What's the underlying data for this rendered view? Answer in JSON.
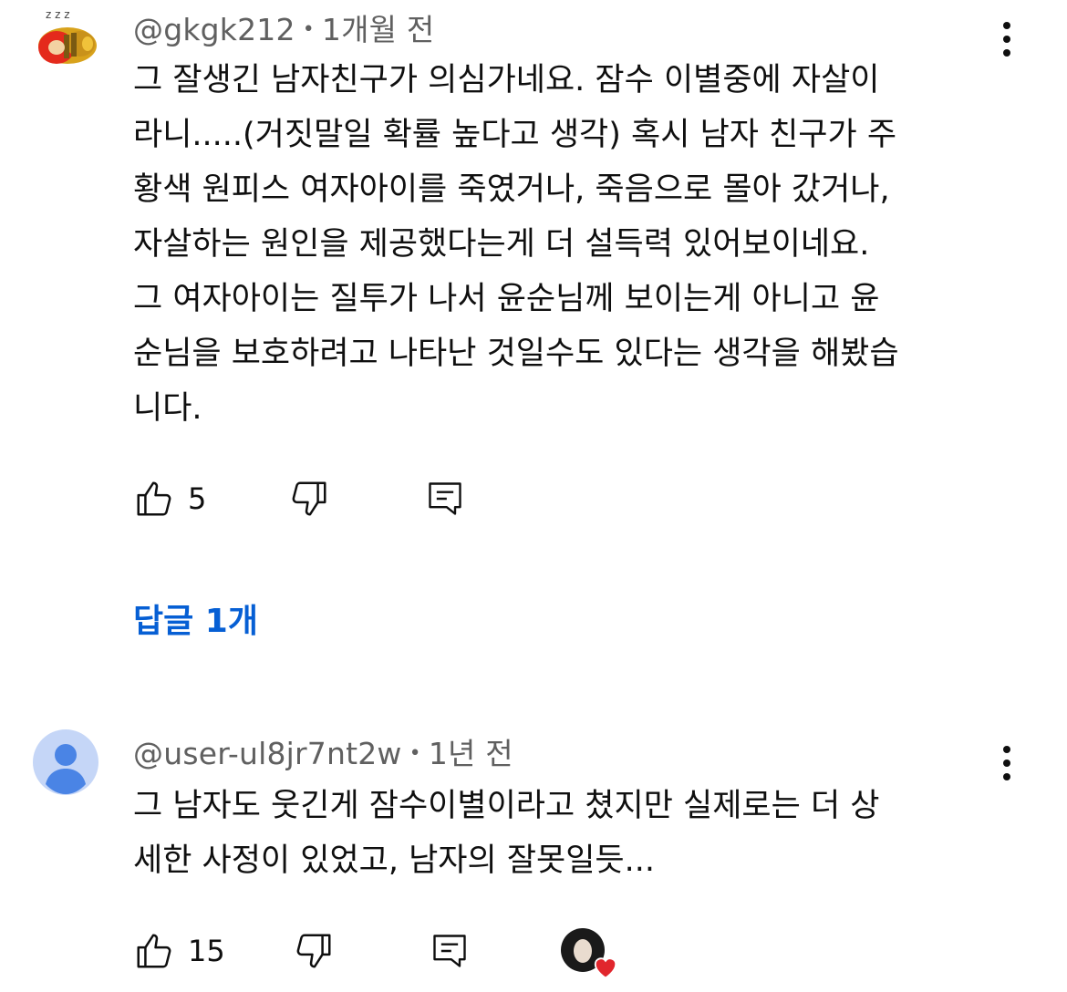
{
  "comments": [
    {
      "author": "@gkgk212",
      "time": "1개월 전",
      "text": "그 잘생긴 남자친구가 의심가네요. 잠수 이별중에 자살이\n라니.....(거짓말일 확률 높다고 생각) 혹시 남자 친구가 주\n황색 원피스 여자아이를 죽였거나,  죽음으로 몰아 갔거나,\n자살하는 원인을 제공했다는게 더 설득력 있어보이네요.\n그 여자아이는 질투가 나서 윤순님께 보이는게 아니고 윤\n순님을 보호하려고 나타난 것일수도 있다는 생각을 해봤습\n니다.",
      "likes": "5",
      "replies_label": "답글 1개",
      "avatar_sleep": "z z z"
    },
    {
      "author": "@user-ul8jr7nt2w",
      "time": "1년 전",
      "text": "그 남자도 웃긴게 잠수이별이라고 쳤지만 실제로는 더 상\n세한 사정이 있었고, 남자의 잘못일듯...",
      "likes": "15"
    }
  ],
  "separator": "•",
  "colors": {
    "link_blue": "#065fd4",
    "meta_gray": "#606060",
    "default_avatar_bg": "#c5d6f7",
    "default_avatar_fg": "#4a84e5",
    "heart_red": "#e1262d"
  },
  "icons": [
    "like-icon",
    "dislike-icon",
    "reply-icon",
    "more-vert-icon",
    "creator-heart-icon"
  ]
}
